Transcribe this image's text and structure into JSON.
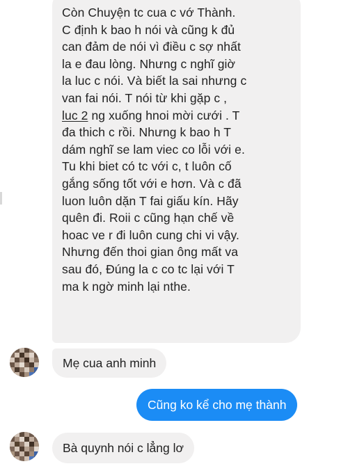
{
  "conversation": {
    "long_message": {
      "lines": [
        "Còn Chuyện tc cua c vớ Thành.",
        "C định k bao h nói và cũng k đủ",
        "can đảm de nói vì điều c sợ nhất",
        "la e đau lòng. Nhưng c nghĩ giờ",
        "la luc c nói. Và biết la sai nhưng c",
        "van fai nói. T nói từ khi gặp c ,",
        "ng xuống hnoi mời cưới . T",
        "đa thich c rồi. Nhưng k bao h T",
        "dám nghĩ se lam viec co lỗi với e.",
        "Tu khi biet có tc với c, t luôn cố",
        "gắng sống tốt với e hơn. Và c đã",
        "luon luôn dặn T fai giấu kín. Hãy",
        "quên đi. Roii c cũng hạn chế về",
        "hoac ve r đi luôn cung chi vi vậy.",
        "Nhưng đến thoi gian ông mất  va",
        "sau đó, Đúng la c co tc lại với T",
        "ma k ngờ minh lại nthe."
      ],
      "underlined_fragment": "luc 2"
    },
    "message_2": "Mẹ cua anh minh",
    "message_3": "Cũng ko kể cho mẹ thành",
    "message_4": "Bà quynh nói c lẳng lơ"
  },
  "colors": {
    "incoming_bubble": "#f1f0f0",
    "outgoing_bubble": "#1b8cf5",
    "incoming_text": "#222222",
    "outgoing_text": "#ffffff"
  }
}
